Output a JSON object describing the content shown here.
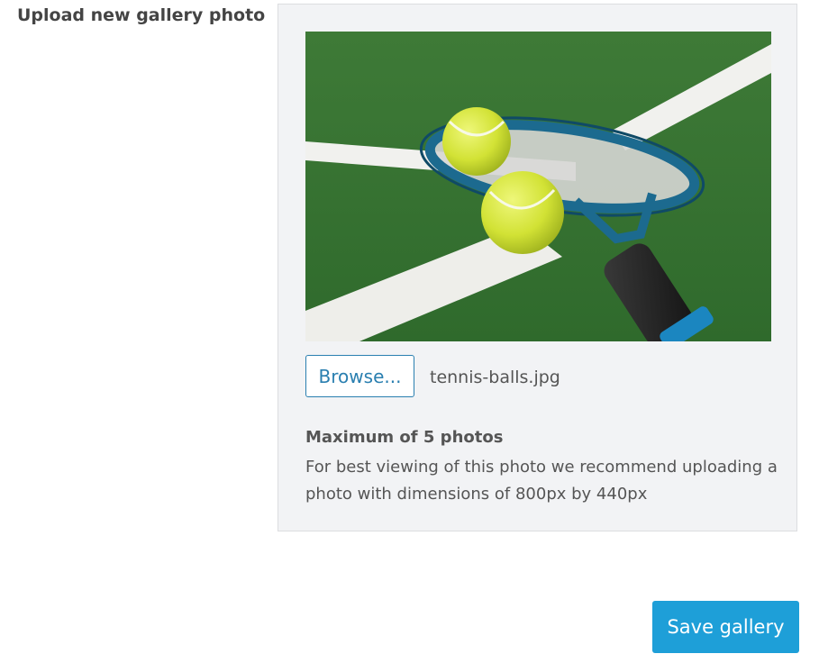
{
  "field": {
    "label": "Upload new gallery photo"
  },
  "upload": {
    "browse_label": "Browse...",
    "file_name": "tennis-balls.jpg",
    "max_note": "Maximum of 5 photos",
    "hint": "For best viewing of this photo we recommend uploading a photo with dimensions of 800px by 440px"
  },
  "actions": {
    "save_label": "Save gallery"
  },
  "colors": {
    "accent": "#1e9fd8",
    "link": "#2a7fb0",
    "court": "#3f7a33",
    "ball": "#d4e63b",
    "racket": "#1b6f91"
  }
}
